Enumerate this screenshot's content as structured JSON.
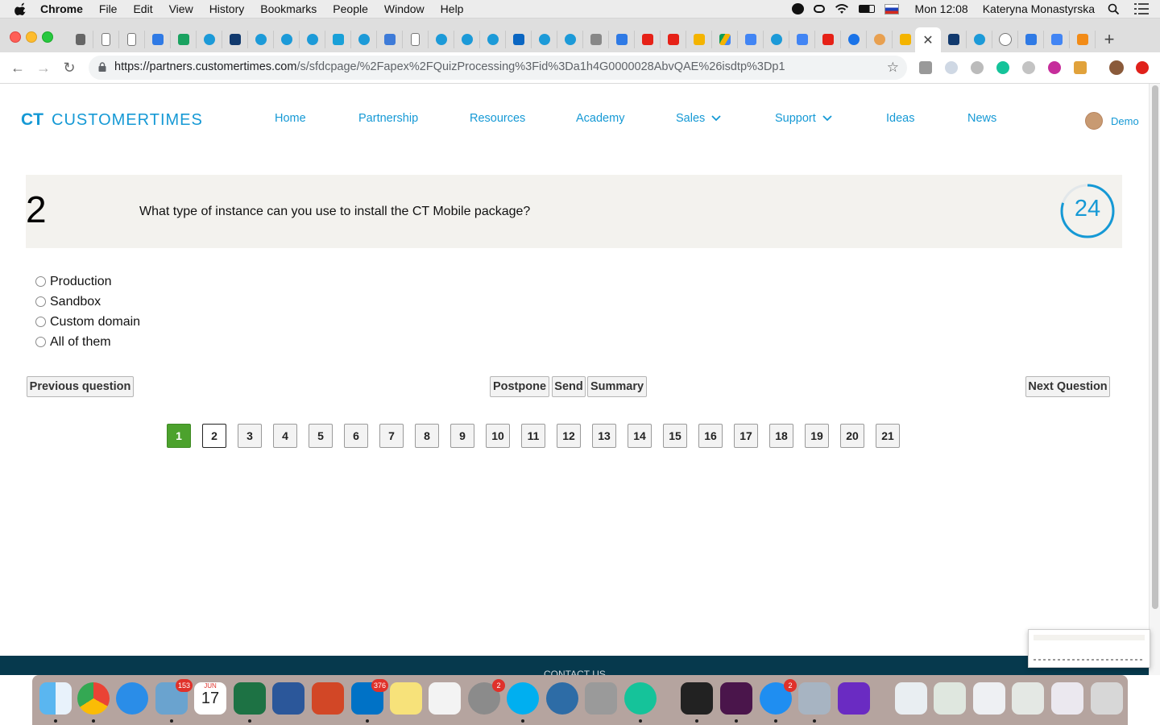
{
  "menubar": {
    "app_name": "Chrome",
    "menus": [
      "File",
      "Edit",
      "View",
      "History",
      "Bookmarks",
      "People",
      "Window",
      "Help"
    ],
    "clock": "Mon 12:08",
    "user": "Kateryna Monastyrska"
  },
  "browser": {
    "active_tab_close": "✕",
    "new_tab": "+",
    "url_host": "https://partners.customertimes.com",
    "url_path": "/s/sfdcpage/%2Fapex%2FQuizProcessing%3Fid%3Da1h4G0000028AbvQAE%26isdtp%3Dp1"
  },
  "site": {
    "logo_ct": "CT",
    "logo_text": "CUSTOMERTIMES",
    "nav": [
      "Home",
      "Partnership",
      "Resources",
      "Academy",
      "Sales",
      "Support",
      "Ideas",
      "News"
    ],
    "user_name": "Demo"
  },
  "quiz": {
    "question_number": "2",
    "question_text": "What type of instance can you use to install the CT Mobile package?",
    "timer": "24",
    "timer_fraction": 0.8,
    "options": [
      "Production",
      "Sandbox",
      "Custom domain",
      "All of them"
    ],
    "buttons": {
      "previous": "Previous question",
      "postpone": "Postpone",
      "send": "Send",
      "summary": "Summary",
      "next": "Next Question"
    },
    "pages": [
      "1",
      "2",
      "3",
      "4",
      "5",
      "6",
      "7",
      "8",
      "9",
      "10",
      "11",
      "12",
      "13",
      "14",
      "15",
      "16",
      "17",
      "18",
      "19",
      "20",
      "21"
    ],
    "completed_page": "1",
    "current_page": "2"
  },
  "footer": {
    "contact": "CONTACT US"
  },
  "dock": {
    "badges": {
      "mail": "153",
      "system_prefs": "2",
      "outlook": "376",
      "app_store": "2"
    },
    "calendar_month": "JUN",
    "calendar_day": "17"
  },
  "colors": {
    "brand": "#1599d5",
    "complete": "#4ca22d",
    "footer": "#06394d",
    "question_bg": "#f3f2ee"
  }
}
